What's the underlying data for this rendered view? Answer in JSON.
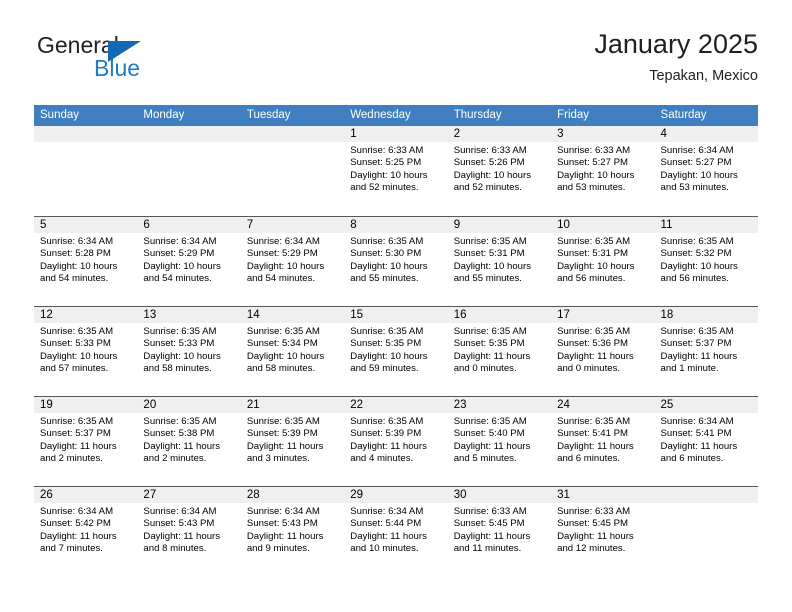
{
  "brand": {
    "name_primary": "General",
    "name_secondary": "Blue",
    "triangle_color": "#1268b3",
    "blue_text_color": "#1f7bc4"
  },
  "header": {
    "title": "January 2025",
    "subtitle": "Tepakan, Mexico"
  },
  "theme": {
    "header_row_bg": "#3f7fbf",
    "date_strip_bg": "#efefef",
    "week_divider": "#54585a"
  },
  "calendar": {
    "weekdays": [
      "Sunday",
      "Monday",
      "Tuesday",
      "Wednesday",
      "Thursday",
      "Friday",
      "Saturday"
    ],
    "weeks": [
      [
        {
          "day": "",
          "lines": []
        },
        {
          "day": "",
          "lines": []
        },
        {
          "day": "",
          "lines": []
        },
        {
          "day": "1",
          "lines": [
            "Sunrise: 6:33 AM",
            "Sunset: 5:25 PM",
            "Daylight: 10 hours",
            "and 52 minutes."
          ]
        },
        {
          "day": "2",
          "lines": [
            "Sunrise: 6:33 AM",
            "Sunset: 5:26 PM",
            "Daylight: 10 hours",
            "and 52 minutes."
          ]
        },
        {
          "day": "3",
          "lines": [
            "Sunrise: 6:33 AM",
            "Sunset: 5:27 PM",
            "Daylight: 10 hours",
            "and 53 minutes."
          ]
        },
        {
          "day": "4",
          "lines": [
            "Sunrise: 6:34 AM",
            "Sunset: 5:27 PM",
            "Daylight: 10 hours",
            "and 53 minutes."
          ]
        }
      ],
      [
        {
          "day": "5",
          "lines": [
            "Sunrise: 6:34 AM",
            "Sunset: 5:28 PM",
            "Daylight: 10 hours",
            "and 54 minutes."
          ]
        },
        {
          "day": "6",
          "lines": [
            "Sunrise: 6:34 AM",
            "Sunset: 5:29 PM",
            "Daylight: 10 hours",
            "and 54 minutes."
          ]
        },
        {
          "day": "7",
          "lines": [
            "Sunrise: 6:34 AM",
            "Sunset: 5:29 PM",
            "Daylight: 10 hours",
            "and 54 minutes."
          ]
        },
        {
          "day": "8",
          "lines": [
            "Sunrise: 6:35 AM",
            "Sunset: 5:30 PM",
            "Daylight: 10 hours",
            "and 55 minutes."
          ]
        },
        {
          "day": "9",
          "lines": [
            "Sunrise: 6:35 AM",
            "Sunset: 5:31 PM",
            "Daylight: 10 hours",
            "and 55 minutes."
          ]
        },
        {
          "day": "10",
          "lines": [
            "Sunrise: 6:35 AM",
            "Sunset: 5:31 PM",
            "Daylight: 10 hours",
            "and 56 minutes."
          ]
        },
        {
          "day": "11",
          "lines": [
            "Sunrise: 6:35 AM",
            "Sunset: 5:32 PM",
            "Daylight: 10 hours",
            "and 56 minutes."
          ]
        }
      ],
      [
        {
          "day": "12",
          "lines": [
            "Sunrise: 6:35 AM",
            "Sunset: 5:33 PM",
            "Daylight: 10 hours",
            "and 57 minutes."
          ]
        },
        {
          "day": "13",
          "lines": [
            "Sunrise: 6:35 AM",
            "Sunset: 5:33 PM",
            "Daylight: 10 hours",
            "and 58 minutes."
          ]
        },
        {
          "day": "14",
          "lines": [
            "Sunrise: 6:35 AM",
            "Sunset: 5:34 PM",
            "Daylight: 10 hours",
            "and 58 minutes."
          ]
        },
        {
          "day": "15",
          "lines": [
            "Sunrise: 6:35 AM",
            "Sunset: 5:35 PM",
            "Daylight: 10 hours",
            "and 59 minutes."
          ]
        },
        {
          "day": "16",
          "lines": [
            "Sunrise: 6:35 AM",
            "Sunset: 5:35 PM",
            "Daylight: 11 hours",
            "and 0 minutes."
          ]
        },
        {
          "day": "17",
          "lines": [
            "Sunrise: 6:35 AM",
            "Sunset: 5:36 PM",
            "Daylight: 11 hours",
            "and 0 minutes."
          ]
        },
        {
          "day": "18",
          "lines": [
            "Sunrise: 6:35 AM",
            "Sunset: 5:37 PM",
            "Daylight: 11 hours",
            "and 1 minute."
          ]
        }
      ],
      [
        {
          "day": "19",
          "lines": [
            "Sunrise: 6:35 AM",
            "Sunset: 5:37 PM",
            "Daylight: 11 hours",
            "and 2 minutes."
          ]
        },
        {
          "day": "20",
          "lines": [
            "Sunrise: 6:35 AM",
            "Sunset: 5:38 PM",
            "Daylight: 11 hours",
            "and 2 minutes."
          ]
        },
        {
          "day": "21",
          "lines": [
            "Sunrise: 6:35 AM",
            "Sunset: 5:39 PM",
            "Daylight: 11 hours",
            "and 3 minutes."
          ]
        },
        {
          "day": "22",
          "lines": [
            "Sunrise: 6:35 AM",
            "Sunset: 5:39 PM",
            "Daylight: 11 hours",
            "and 4 minutes."
          ]
        },
        {
          "day": "23",
          "lines": [
            "Sunrise: 6:35 AM",
            "Sunset: 5:40 PM",
            "Daylight: 11 hours",
            "and 5 minutes."
          ]
        },
        {
          "day": "24",
          "lines": [
            "Sunrise: 6:35 AM",
            "Sunset: 5:41 PM",
            "Daylight: 11 hours",
            "and 6 minutes."
          ]
        },
        {
          "day": "25",
          "lines": [
            "Sunrise: 6:34 AM",
            "Sunset: 5:41 PM",
            "Daylight: 11 hours",
            "and 6 minutes."
          ]
        }
      ],
      [
        {
          "day": "26",
          "lines": [
            "Sunrise: 6:34 AM",
            "Sunset: 5:42 PM",
            "Daylight: 11 hours",
            "and 7 minutes."
          ]
        },
        {
          "day": "27",
          "lines": [
            "Sunrise: 6:34 AM",
            "Sunset: 5:43 PM",
            "Daylight: 11 hours",
            "and 8 minutes."
          ]
        },
        {
          "day": "28",
          "lines": [
            "Sunrise: 6:34 AM",
            "Sunset: 5:43 PM",
            "Daylight: 11 hours",
            "and 9 minutes."
          ]
        },
        {
          "day": "29",
          "lines": [
            "Sunrise: 6:34 AM",
            "Sunset: 5:44 PM",
            "Daylight: 11 hours",
            "and 10 minutes."
          ]
        },
        {
          "day": "30",
          "lines": [
            "Sunrise: 6:33 AM",
            "Sunset: 5:45 PM",
            "Daylight: 11 hours",
            "and 11 minutes."
          ]
        },
        {
          "day": "31",
          "lines": [
            "Sunrise: 6:33 AM",
            "Sunset: 5:45 PM",
            "Daylight: 11 hours",
            "and 12 minutes."
          ]
        },
        {
          "day": "",
          "lines": []
        }
      ]
    ]
  }
}
